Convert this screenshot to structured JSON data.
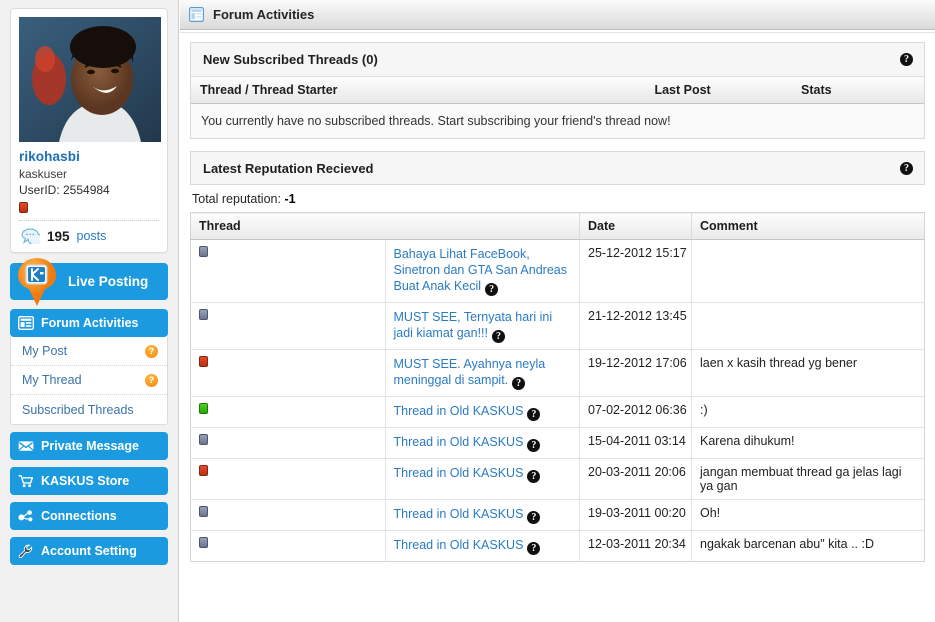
{
  "sidebar": {
    "profile": {
      "avatar_alt": "user-avatar-photo",
      "username": "rikohasbi",
      "role": "kaskuser",
      "userid_label": "UserID: 2554984",
      "reputation_chip": "negative",
      "posts_count": "195",
      "posts_word": "posts",
      "posts_icon": "speech-bubble-icon"
    },
    "live_posting": {
      "label": "Live Posting",
      "icon": "kaskus-pin-icon"
    },
    "nav": [
      {
        "id": "forum-activities",
        "label": "Forum Activities",
        "icon": "layout-grid-icon",
        "active": true,
        "children": [
          {
            "id": "my-post",
            "label": "My Post",
            "badge": "?"
          },
          {
            "id": "my-thread",
            "label": "My Thread",
            "badge": "?"
          },
          {
            "id": "subscribed-threads",
            "label": "Subscribed Threads",
            "badge": ""
          }
        ]
      },
      {
        "id": "private-message",
        "label": "Private Message",
        "icon": "envelope-icon",
        "children": []
      },
      {
        "id": "kaskus-store",
        "label": "KASKUS Store",
        "icon": "shopping-cart-icon",
        "children": []
      },
      {
        "id": "connections",
        "label": "Connections",
        "icon": "connections-icon",
        "children": []
      },
      {
        "id": "account-setting",
        "label": "Account Setting",
        "icon": "wrench-icon",
        "children": []
      }
    ]
  },
  "header": {
    "title": "Forum Activities",
    "icon": "panel-layout-icon"
  },
  "subscribed_panel": {
    "title": "New Subscribed Threads (0)",
    "help_icon": "help-question-icon",
    "columns": [
      "Thread / Thread Starter",
      "Last Post",
      "Stats"
    ],
    "empty_message": "You currently have no subscribed threads. Start subscribing your friend's thread now!"
  },
  "reputation_panel": {
    "title": "Latest Reputation Recieved",
    "help_icon": "help-question-icon",
    "total_label": "Total reputation:",
    "total_value": "-1",
    "columns": [
      "Thread",
      "Date",
      "Comment"
    ],
    "rows": [
      {
        "chip": "neutral",
        "thread": "Bahaya Lihat FaceBook, Sinetron dan GTA San Andreas Buat Anak Kecil",
        "date": "25-12-2012 15:17",
        "comment": ""
      },
      {
        "chip": "neutral",
        "thread": "MUST SEE, Ternyata hari ini jadi kiamat gan!!!",
        "date": "21-12-2012 13:45",
        "comment": ""
      },
      {
        "chip": "negative",
        "thread": "MUST SEE. Ayahnya neyla meninggal di sampit.",
        "date": "19-12-2012 17:06",
        "comment": "laen x kasih thread yg bener"
      },
      {
        "chip": "positive",
        "thread": "Thread in Old KASKUS",
        "date": "07-02-2012 06:36",
        "comment": ":)"
      },
      {
        "chip": "neutral",
        "thread": "Thread in Old KASKUS",
        "date": "15-04-2011 03:14",
        "comment": "Karena dihukum!"
      },
      {
        "chip": "negative",
        "thread": "Thread in Old KASKUS",
        "date": "20-03-2011 20:06",
        "comment": "jangan membuat thread ga jelas lagi ya gan"
      },
      {
        "chip": "neutral",
        "thread": "Thread in Old KASKUS",
        "date": "19-03-2011 00:20",
        "comment": "Oh!"
      },
      {
        "chip": "neutral",
        "thread": "Thread in Old KASKUS",
        "date": "12-03-2011 20:34",
        "comment": "ngakak barcenan abu\" kita .. :D"
      }
    ]
  },
  "colors": {
    "brand_blue": "#1b9ae0",
    "link_blue": "#2a7bc4",
    "username_blue": "#1b6fba",
    "badge_orange": "#f08a10",
    "chip_negative": "#d63a1c",
    "chip_positive": "#2fbb10",
    "chip_neutral": "#7a melhor"
  }
}
